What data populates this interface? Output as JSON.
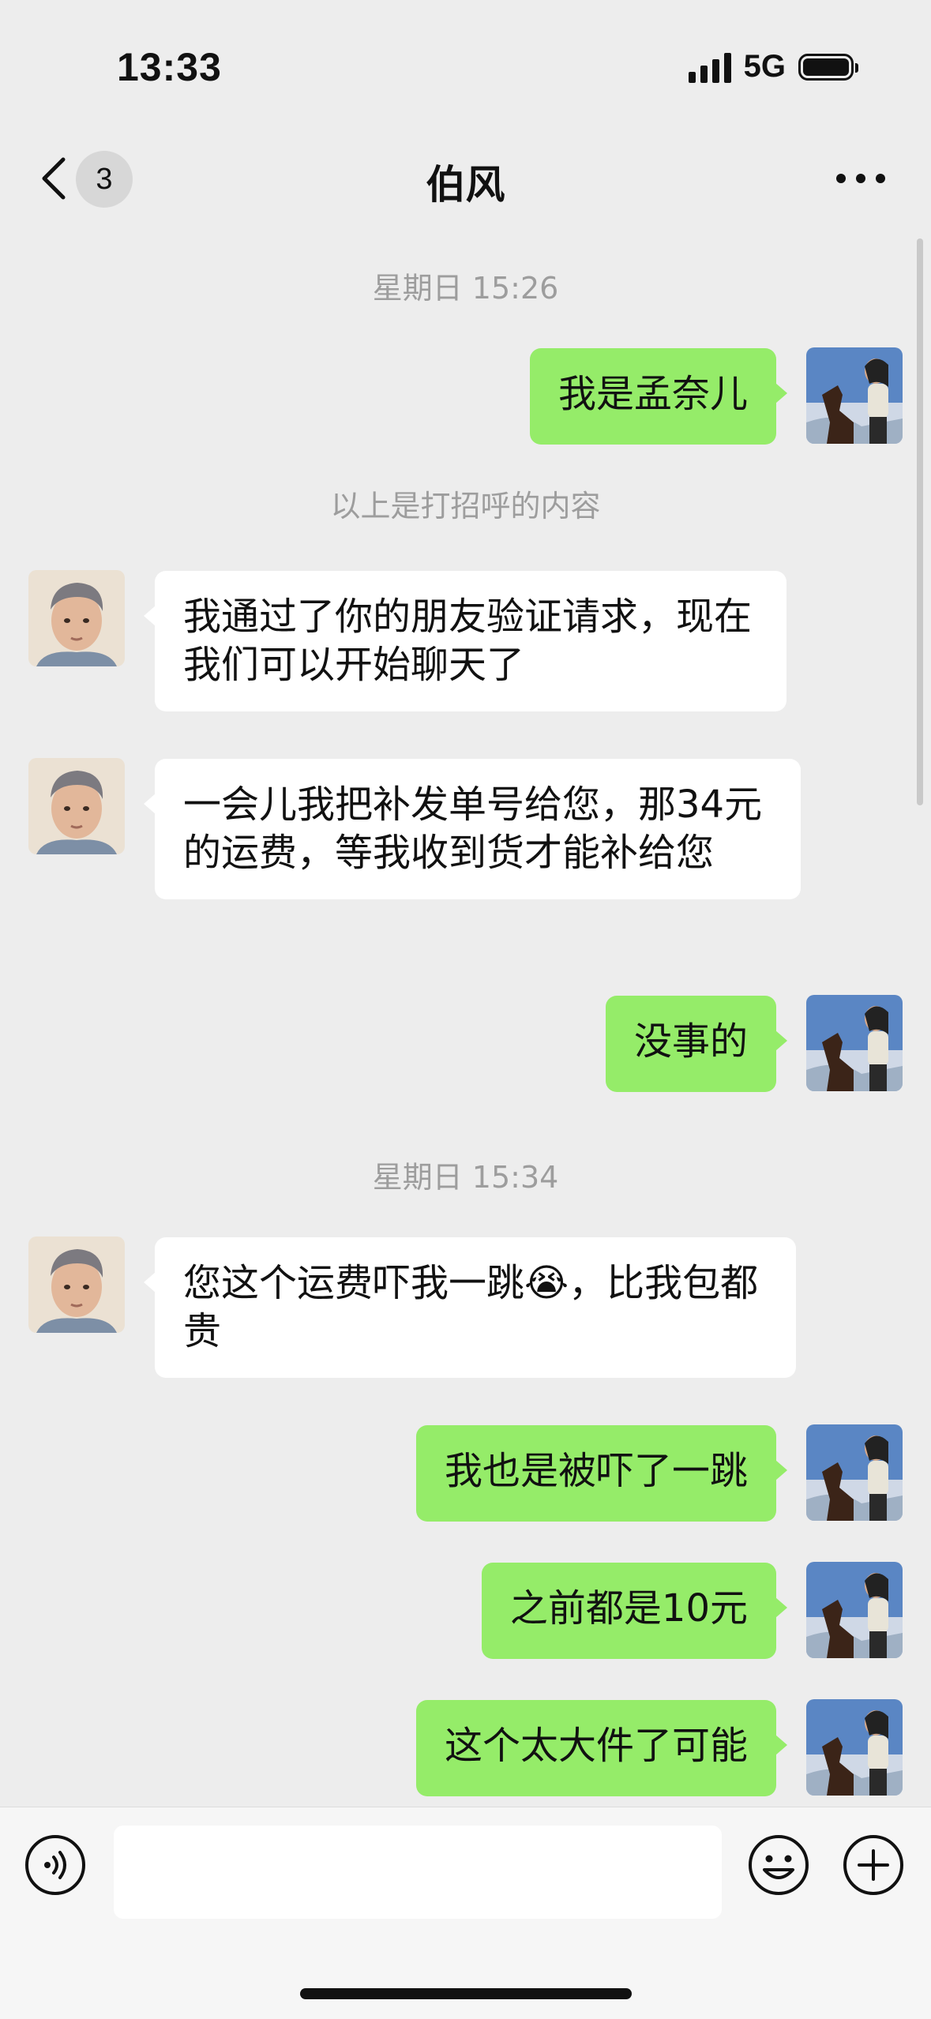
{
  "status_bar": {
    "time": "13:33",
    "network": "5G"
  },
  "nav": {
    "unread_count": "3",
    "title": "伯风"
  },
  "chat": {
    "timestamp_1": "星期日 15:26",
    "greeting_note": "以上是打招呼的内容",
    "timestamp_2": "星期日 15:34",
    "messages": [
      {
        "sender": "me",
        "text": "我是孟奈儿"
      },
      {
        "sender": "other",
        "text": "我通过了你的朋友验证请求，现在我们可以开始聊天了"
      },
      {
        "sender": "other",
        "text": "一会儿我把补发单号给您，那34元的运费，等我收到货才能补给您"
      },
      {
        "sender": "me",
        "text": "没事的"
      },
      {
        "sender": "other",
        "text_before_emoji": "您这个运费吓我一跳",
        "emoji": "😭",
        "text_after_emoji": "，比我包都贵"
      },
      {
        "sender": "me",
        "text": "我也是被吓了一跳"
      },
      {
        "sender": "me",
        "text": "之前都是10元"
      },
      {
        "sender": "me",
        "text": "这个太大件了可能"
      }
    ]
  },
  "icons": {
    "back": "chevron-left-icon",
    "more": "more-dots-icon",
    "voice": "voice-input-icon",
    "emoji": "emoji-icon",
    "plus": "plus-icon"
  },
  "colors": {
    "background": "#ededed",
    "my_bubble": "#95ec69",
    "other_bubble": "#ffffff",
    "timestamp_text": "#9d9d9d"
  }
}
